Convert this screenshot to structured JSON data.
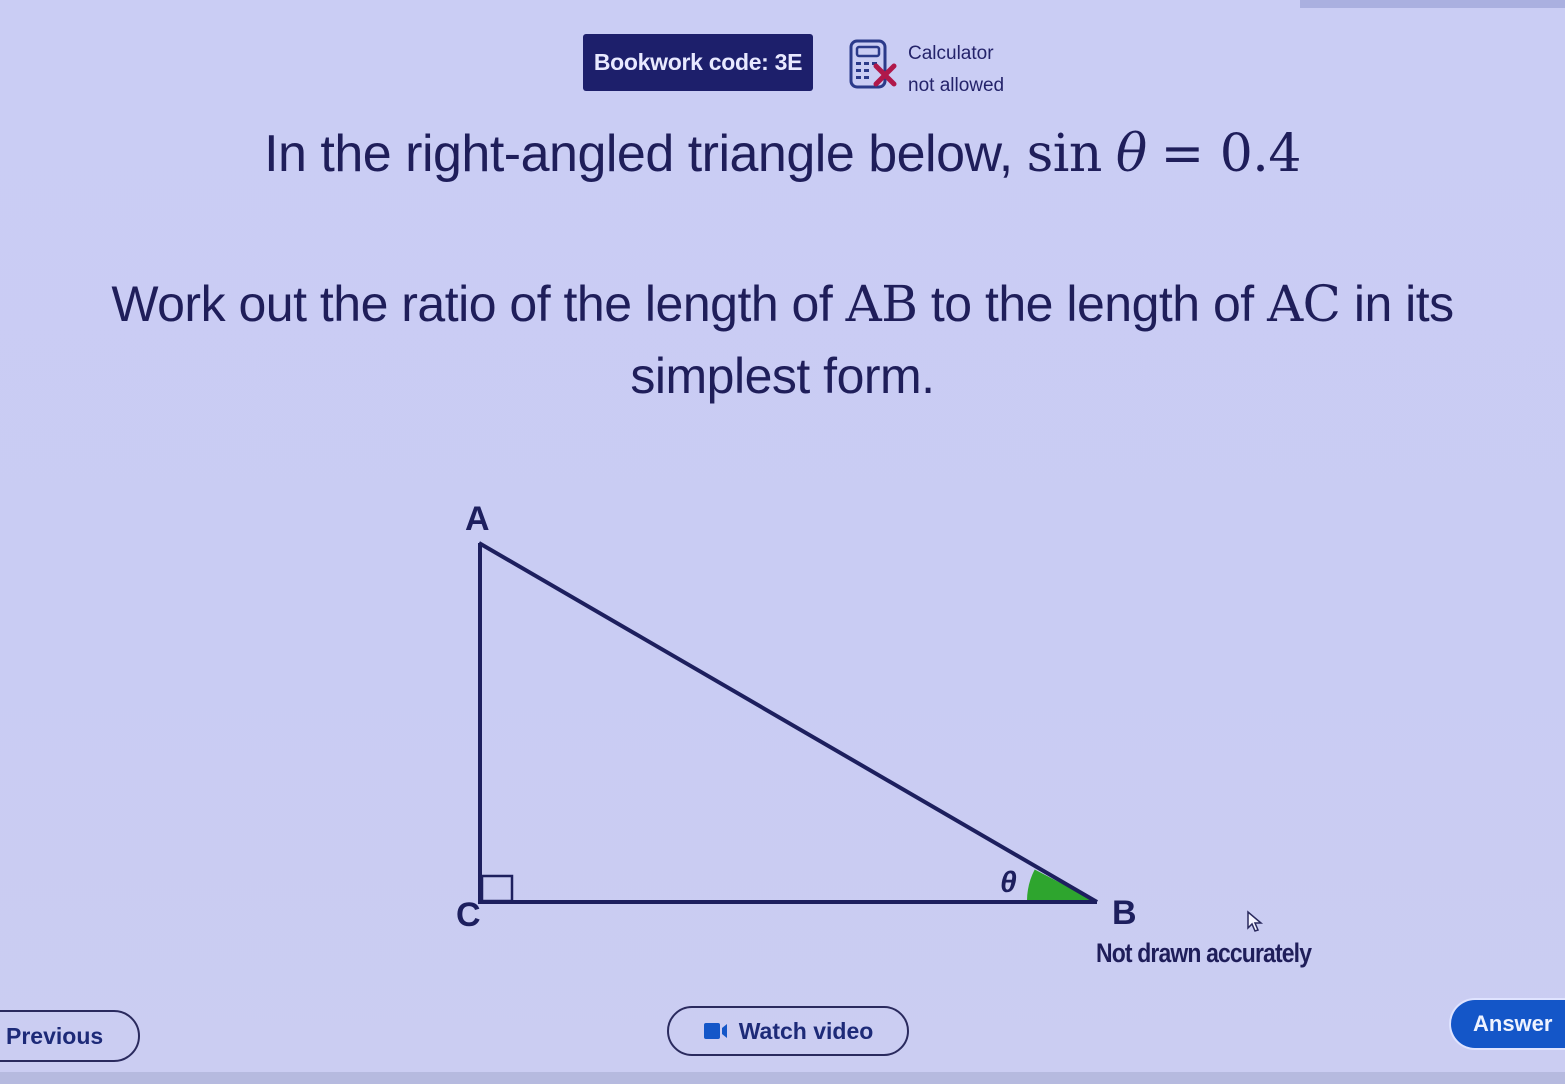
{
  "header": {
    "bookwork_code": "Bookwork code: 3E",
    "calculator_line1": "Calculator",
    "calculator_line2": "not allowed",
    "calculator_icon": "calculator-crossed-icon"
  },
  "question": {
    "line1_text": "In the right-angled triangle below, ",
    "line1_math_func": "sin",
    "line1_math_var": "θ",
    "line1_math_eq": "= 0.4",
    "line2_part1": "Work out the ratio of the length of ",
    "line2_seg1": "AB",
    "line2_part2": " to the length of ",
    "line2_seg2": "AC",
    "line2_part3": " in its",
    "line3": "simplest form."
  },
  "diagram": {
    "vertex_a": "A",
    "vertex_b": "B",
    "vertex_c": "C",
    "angle_label": "θ",
    "right_angle_at": "C",
    "marked_angle_at": "B",
    "line_color": "#1d1f5e",
    "angle_fill_color": "#2ea52e",
    "note": "Not drawn accurately"
  },
  "footer": {
    "previous_label": "Previous",
    "watch_video_label": "Watch video",
    "video_icon": "video-camera-icon",
    "answer_label": "Answer",
    "answer_color": "#1456c8"
  }
}
